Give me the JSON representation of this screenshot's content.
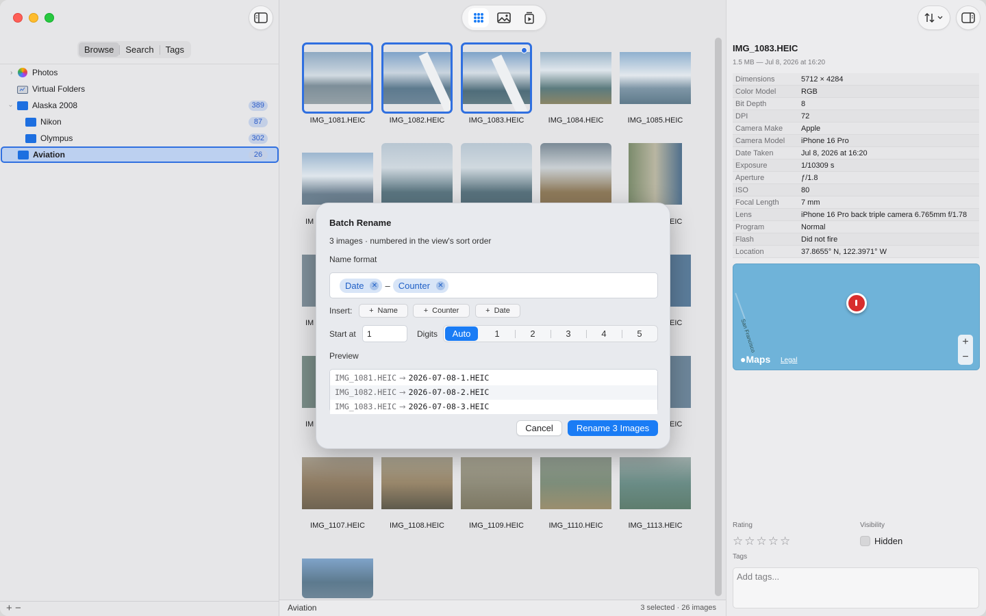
{
  "sidebar": {
    "tabs": [
      {
        "label": "Browse",
        "active": true
      },
      {
        "label": "Search",
        "active": false
      },
      {
        "label": "Tags",
        "active": false
      }
    ],
    "tree": [
      {
        "label": "Photos",
        "icon": "photos-icon",
        "count": "",
        "level": 0,
        "expanded": false
      },
      {
        "label": "Virtual Folders",
        "icon": "virtual-folders-icon",
        "count": "",
        "level": 0,
        "expanded": null
      },
      {
        "label": "Alaska 2008",
        "icon": "folder-icon",
        "count": "389",
        "level": 0,
        "expanded": true
      },
      {
        "label": "Nikon",
        "icon": "folder-icon",
        "count": "87",
        "level": 1
      },
      {
        "label": "Olympus",
        "icon": "folder-icon",
        "count": "302",
        "level": 1
      },
      {
        "label": "Aviation",
        "icon": "folder-icon",
        "count": "26",
        "level": 0,
        "selected": true
      }
    ],
    "bottom": {
      "add": "+",
      "remove": "−"
    }
  },
  "grid": {
    "rows": [
      [
        "IMG_1081.HEIC",
        "IMG_1082.HEIC",
        "IMG_1083.HEIC",
        "IMG_1084.HEIC",
        "IMG_1085.HEIC"
      ],
      [
        "IMG_1107.HEIC",
        "IMG_1108.HEIC",
        "IMG_1109.HEIC",
        "IMG_1110.HEIC",
        "IMG_1113.HEIC"
      ]
    ],
    "partial_caption_left": "IM",
    "partial_caption_right": "EIC"
  },
  "status": {
    "folder": "Aviation",
    "summary": "3 selected · 26 images"
  },
  "inspector": {
    "title": "IMG_1083.HEIC",
    "subtitle": "1.5 MB — Jul 8, 2026 at 16:20",
    "metadata": [
      {
        "k": "Dimensions",
        "v": "5712 × 4284"
      },
      {
        "k": "Color Model",
        "v": "RGB"
      },
      {
        "k": "Bit Depth",
        "v": "8"
      },
      {
        "k": "DPI",
        "v": "72"
      },
      {
        "k": "Camera Make",
        "v": "Apple"
      },
      {
        "k": "Camera Model",
        "v": "iPhone 16 Pro"
      },
      {
        "k": "Date Taken",
        "v": "Jul 8, 2026 at 16:20"
      },
      {
        "k": "Exposure",
        "v": "1/10309 s"
      },
      {
        "k": "Aperture",
        "v": "ƒ/1.8"
      },
      {
        "k": "ISO",
        "v": "80"
      },
      {
        "k": "Focal Length",
        "v": "7 mm"
      },
      {
        "k": "Lens",
        "v": "iPhone 16 Pro back triple camera 6.765mm f/1.78"
      },
      {
        "k": "Program",
        "v": "Normal"
      },
      {
        "k": "Flash",
        "v": "Did not fire"
      },
      {
        "k": "Location",
        "v": "37.8655° N, 122.3971° W"
      }
    ],
    "map": {
      "logo": "Maps",
      "legal": "Legal",
      "zoom_in": "+",
      "zoom_out": "−",
      "street": "San Francisco"
    },
    "rating_label": "Rating",
    "visibility_label": "Visibility",
    "hidden_label": "Hidden",
    "tags_label": "Tags",
    "tags_placeholder": "Add tags...",
    "stars": "☆☆☆☆☆"
  },
  "dialog": {
    "title": "Batch Rename",
    "subtitle": "3 images · numbered in the view's sort order",
    "name_format_label": "Name format",
    "tokens": [
      "Date",
      "Counter"
    ],
    "separator": "–",
    "insert_label": "Insert:",
    "insert_buttons": [
      "Name",
      "Counter",
      "Date"
    ],
    "start_at_label": "Start at",
    "start_at_value": "1",
    "digits_label": "Digits",
    "digits_options": [
      "Auto",
      "1",
      "2",
      "3",
      "4",
      "5"
    ],
    "preview_label": "Preview",
    "preview": [
      {
        "old": "IMG_1081.HEIC",
        "new": "2026-07-08-1.HEIC"
      },
      {
        "old": "IMG_1082.HEIC",
        "new": "2026-07-08-2.HEIC"
      },
      {
        "old": "IMG_1083.HEIC",
        "new": "2026-07-08-3.HEIC"
      }
    ],
    "cancel_label": "Cancel",
    "confirm_label": "Rename 3 Images"
  },
  "colors": {
    "accent": "#1a7cf5",
    "selection": "#2f6fe0"
  }
}
